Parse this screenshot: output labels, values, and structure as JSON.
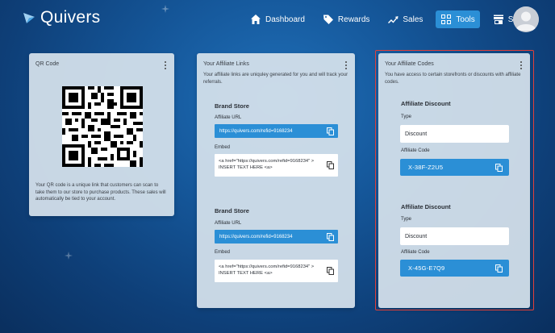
{
  "app": {
    "name": "Quivers"
  },
  "nav": [
    {
      "label": "Dashboard",
      "icon": "home-icon"
    },
    {
      "label": "Rewards",
      "icon": "tag-icon"
    },
    {
      "label": "Sales",
      "icon": "trend-icon"
    },
    {
      "label": "Tools",
      "icon": "grid-icon",
      "active": true
    },
    {
      "label": "Shop",
      "icon": "store-icon"
    }
  ],
  "qr_card": {
    "title": "QR Code",
    "description": "Your QR code is a unique link that customers can scan to take them to our store to purchase products. These sales will automatically be tied to your account."
  },
  "links_card": {
    "title": "Your Affiliate Links",
    "description": "Your affiliate links are uniquley generated for you and will track your referrals.",
    "sections": [
      {
        "title": "Brand Store",
        "url_label": "Affiliate URL",
        "url": "https://quivers.com/refid=9168234",
        "embed_label": "Embed",
        "embed": "<a href=\"https://quivers.com/refid=9168234\" > INSERT TEXT HERE <a>"
      },
      {
        "title": "Brand Store",
        "url_label": "Affiliate URL",
        "url": "https://quivers.com/refid=9168234",
        "embed_label": "Embed",
        "embed": "<a href=\"https://quivers.com/refid=9168234\" > INSERT TEXT HERE <a>"
      }
    ]
  },
  "codes_card": {
    "title": "Your Affiliate Codes",
    "description": "You have access to certain storefronts or discounts with affiliate codes.",
    "sections": [
      {
        "title": "Affiliate Discount",
        "type_label": "Type",
        "type": "Discount",
        "code_label": "Affiliate Code",
        "code": "X-38F-Z2U5"
      },
      {
        "title": "Affiliate Discount",
        "type_label": "Type",
        "type": "Discount",
        "code_label": "Affiliate Code",
        "code": "X-45G-E7Q9"
      }
    ]
  },
  "colors": {
    "accent": "#2b8fd6",
    "highlight": "#e0403a",
    "background": "#15579a"
  }
}
